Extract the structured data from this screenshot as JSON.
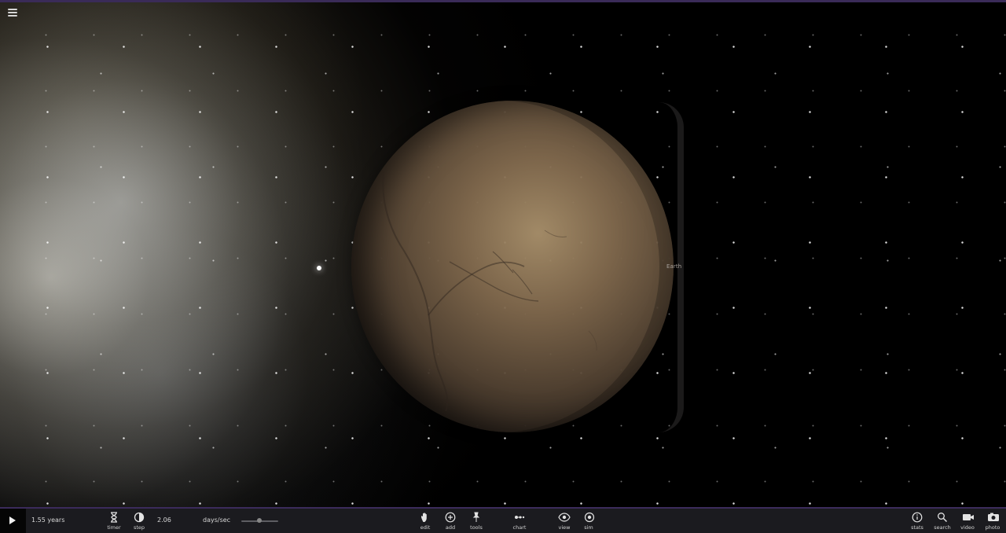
{
  "scene": {
    "planet_label": "Earth"
  },
  "toolbar": {
    "elapsed_time": "1.55 years",
    "timer_label": "timer",
    "step_label": "step",
    "step_value": "2.06",
    "speed_unit": "days/sec",
    "speed_slider_level": 0.45,
    "edit_label": "edit",
    "add_label": "add",
    "tools_label": "tools",
    "chart_label": "chart",
    "view_label": "view",
    "sim_label": "sim",
    "stats_label": "stats",
    "search_label": "search",
    "video_label": "video",
    "photo_label": "photo"
  },
  "icons": {
    "menu": "menu-icon",
    "play": "play-icon",
    "timer": "hourglass-icon",
    "step": "half-circle-icon",
    "edit": "hand-icon",
    "add": "plus-circle-icon",
    "tools": "pin-icon",
    "chart": "orbit-chart-icon",
    "view": "eye-icon",
    "sim": "target-icon",
    "stats": "info-icon",
    "search": "magnifier-icon",
    "video": "camera-video-icon",
    "photo": "camera-icon"
  },
  "colors": {
    "toolbar_background": "#1b1b1f",
    "accent_line": "#3b2b5b",
    "planet_tone": "#8a7152"
  }
}
